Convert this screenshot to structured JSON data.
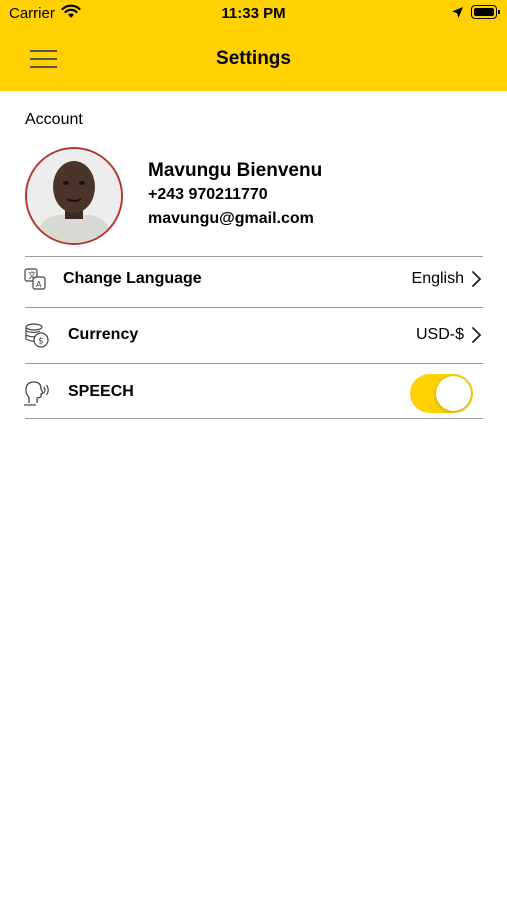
{
  "status_bar": {
    "carrier": "Carrier",
    "time": "11:33 PM"
  },
  "header": {
    "title": "Settings",
    "background_color": "#FFD100"
  },
  "account": {
    "section_label": "Account",
    "name": "Mavungu Bienvenu",
    "phone": "+243 970211770",
    "email": "mavungu@gmail.com"
  },
  "settings": {
    "language": {
      "label": "Change Language",
      "value": "English",
      "icon": "translate-icon"
    },
    "currency": {
      "label": "Currency",
      "value": "USD-$",
      "icon": "coins-icon"
    },
    "speech": {
      "label": "SPEECH",
      "enabled": true,
      "icon": "speaking-head-icon"
    }
  }
}
